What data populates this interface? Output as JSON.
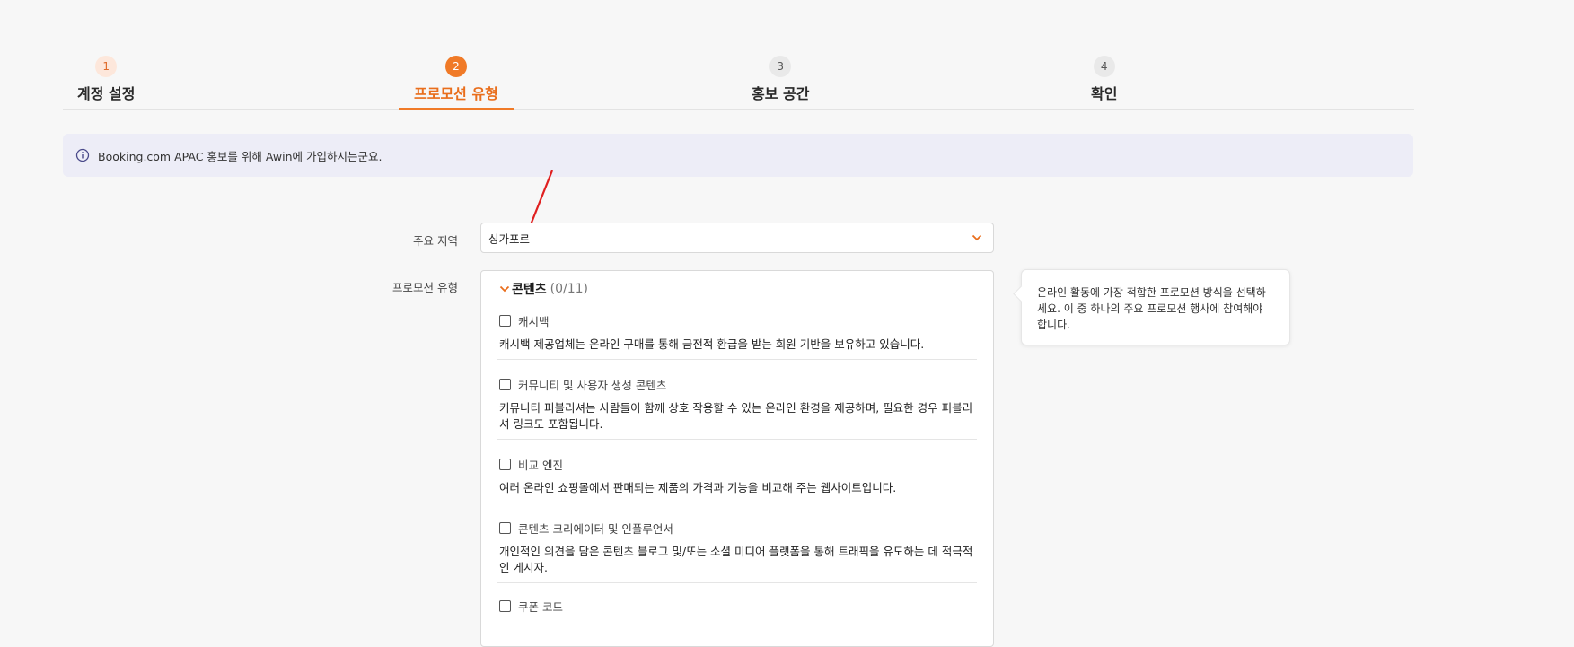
{
  "stepper": {
    "steps": [
      {
        "number": "1",
        "label": "계정 설정",
        "state": "done"
      },
      {
        "number": "2",
        "label": "프로모션 유형",
        "state": "active"
      },
      {
        "number": "3",
        "label": "홍보 공간",
        "state": "pending"
      },
      {
        "number": "4",
        "label": "확인",
        "state": "pending"
      }
    ]
  },
  "banner": {
    "icon": "info-icon",
    "text": "Booking.com APAC 홍보를 위해 Awin에 가입하시는군요."
  },
  "form": {
    "region_label": "주요 지역",
    "region_value": "싱가포르",
    "promotion_label": "프로모션 유형"
  },
  "promotion_panel": {
    "title": "콘텐츠",
    "count": "(0/11)",
    "options": [
      {
        "name": "캐시백",
        "desc": "캐시백 제공업체는 온라인 구매를 통해 금전적 환급을 받는 회원 기반을 보유하고 있습니다.",
        "checked": false
      },
      {
        "name": "커뮤니티 및 사용자 생성 콘텐츠",
        "desc": "커뮤니티 퍼블리셔는 사람들이 함께 상호 작용할 수 있는 온라인 환경을 제공하며, 필요한 경우 퍼블리셔 링크도 포함됩니다.",
        "checked": false
      },
      {
        "name": "비교 엔진",
        "desc": "여러 온라인 쇼핑몰에서 판매되는 제품의 가격과 기능을 비교해 주는 웹사이트입니다.",
        "checked": false
      },
      {
        "name": "콘텐츠 크리에이터 및 인플루언서",
        "desc": "개인적인 의견을 담은 콘텐츠 블로그 및/또는 소셜 미디어 플랫폼을 통해 트래픽을 유도하는 데 적극적인 게시자.",
        "checked": false
      },
      {
        "name": "쿠폰 코드",
        "desc": "",
        "checked": false
      }
    ]
  },
  "tooltip": {
    "text": "온라인 활동에 가장 적합한 프로모션 방식을 선택하세요. 이 중 하나의 주요 프로모션 행사에 참여해야 합니다."
  },
  "colors": {
    "accent": "#f07a27",
    "banner_bg": "#ededf7",
    "annotation_arrow": "#e02020"
  }
}
